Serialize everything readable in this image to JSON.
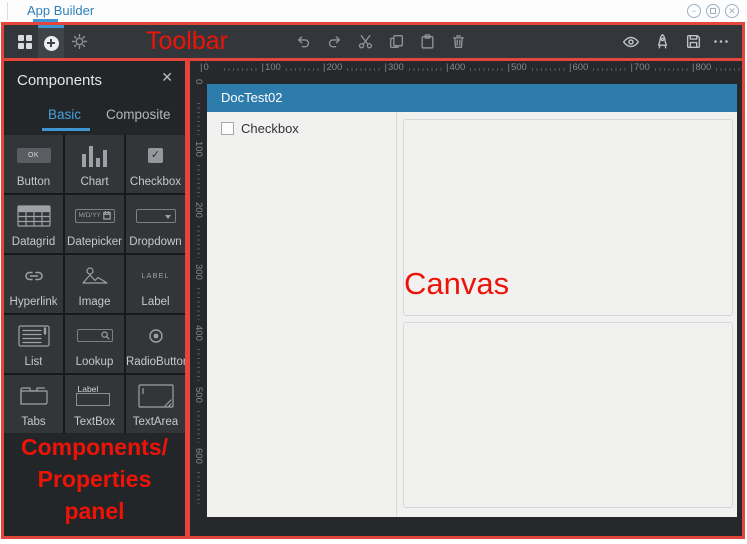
{
  "titlebar": {
    "tab_label": "App Builder"
  },
  "window_controls": {
    "icons": [
      "minimize-icon",
      "maximize-icon",
      "close-icon"
    ]
  },
  "toolbar": {
    "left_icons": [
      "apps-grid",
      "add-component",
      "settings"
    ],
    "center_icons": [
      "undo",
      "redo",
      "cut",
      "copy",
      "paste",
      "delete"
    ],
    "right_icons": [
      "preview",
      "launch",
      "save",
      "more"
    ]
  },
  "components_panel": {
    "title": "Components",
    "tabs": [
      {
        "label": "Basic",
        "active": true
      },
      {
        "label": "Composite",
        "active": false
      }
    ],
    "items": [
      {
        "name": "button",
        "label": "Button",
        "icon_text": "OK"
      },
      {
        "name": "chart",
        "label": "Chart"
      },
      {
        "name": "checkbox",
        "label": "Checkbox",
        "icon_text": "✓"
      },
      {
        "name": "datagrid",
        "label": "Datagrid"
      },
      {
        "name": "datepicker",
        "label": "Datepicker",
        "icon_text": "M/D/YY"
      },
      {
        "name": "dropdown",
        "label": "Dropdown"
      },
      {
        "name": "hyperlink",
        "label": "Hyperlink"
      },
      {
        "name": "image",
        "label": "Image"
      },
      {
        "name": "label",
        "label": "Label",
        "icon_text": "LABEL"
      },
      {
        "name": "list",
        "label": "List"
      },
      {
        "name": "lookup",
        "label": "Lookup"
      },
      {
        "name": "radiobutton",
        "label": "RadioButton"
      },
      {
        "name": "tabs",
        "label": "Tabs"
      },
      {
        "name": "textbox",
        "label": "TextBox",
        "icon_text": "Label"
      },
      {
        "name": "textarea",
        "label": "TextArea"
      }
    ]
  },
  "canvas": {
    "doc_title": "DocTest02",
    "checkbox_label": "Checkbox",
    "ruler_h": [
      "0",
      "100",
      "200",
      "300",
      "400",
      "500",
      "600",
      "700",
      "800"
    ],
    "ruler_v": [
      "0",
      "100",
      "200",
      "300",
      "400",
      "500",
      "600"
    ]
  },
  "annotations": {
    "toolbar_label": "Toolbar",
    "canvas_label": "Canvas",
    "panel_label": "Components/\nProperties\npanel",
    "color": "#e5463c"
  },
  "colors": {
    "accent_blue": "#3d96d2",
    "doc_header_blue": "#2e7cab",
    "toolbar_bg": "#33373b",
    "panel_bg": "#232629",
    "canvas_bg": "#f1f1f0",
    "annotation_red": "#e5463c"
  }
}
